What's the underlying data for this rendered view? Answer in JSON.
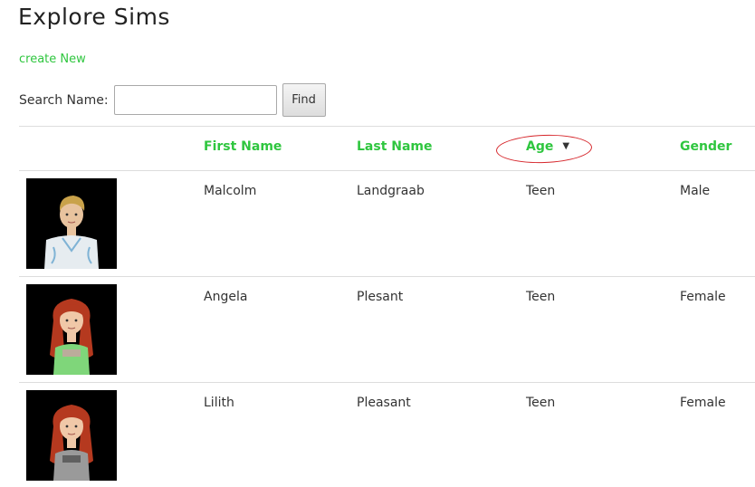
{
  "page": {
    "title": "Explore Sims",
    "create_link": "create New"
  },
  "search": {
    "label": "Search Name:",
    "value": "",
    "placeholder": "",
    "button_label": "Find"
  },
  "table": {
    "columns": {
      "first_name": "First Name",
      "last_name": "Last Name",
      "age": "Age",
      "gender": "Gender"
    },
    "sort": {
      "column": "Age",
      "direction": "descending",
      "indicator": "▼"
    },
    "rows": [
      {
        "first_name": "Malcolm",
        "last_name": "Landgraab",
        "age": "Teen",
        "gender": "Male",
        "colors": {
          "hair": "#c9a24a",
          "skin": "#e8c39e",
          "shirt": "#e6ecf0",
          "accent": "#7fb3d5"
        }
      },
      {
        "first_name": "Angela",
        "last_name": "Plesant",
        "age": "Teen",
        "gender": "Female",
        "colors": {
          "hair": "#b5391f",
          "skin": "#f0c8a8",
          "shirt": "#7fd67a",
          "accent": "#e38fb0"
        }
      },
      {
        "first_name": "Lilith",
        "last_name": "Pleasant",
        "age": "Teen",
        "gender": "Female",
        "colors": {
          "hair": "#b5391f",
          "skin": "#f0c8a8",
          "shirt": "#9a9a9a",
          "accent": "#3a3a3a"
        }
      }
    ]
  },
  "colors": {
    "link_green": "#2fc63f",
    "annotation_red": "#d6262b"
  }
}
